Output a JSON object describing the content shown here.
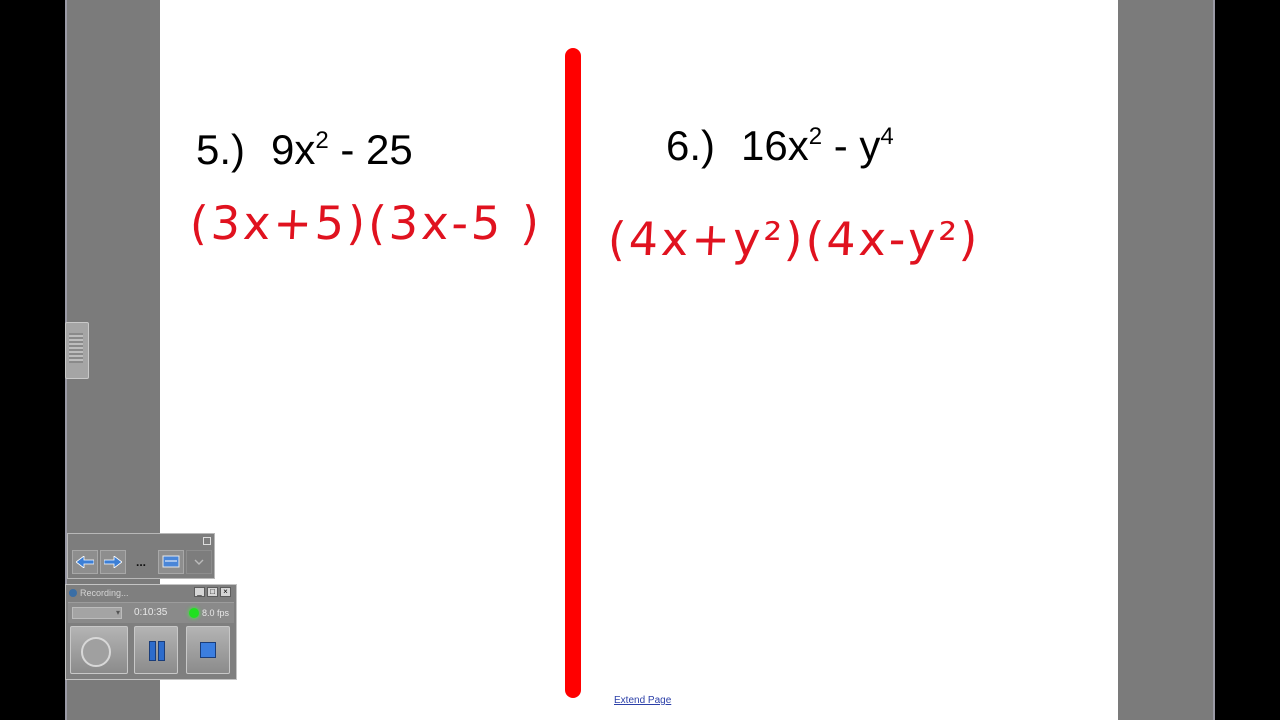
{
  "whiteboard": {
    "problems": [
      {
        "number": "5.)",
        "base": "9x",
        "exp1": "2",
        "rest": " - 25",
        "exp2": ""
      },
      {
        "number": "6.)",
        "base": "16x",
        "exp1": "2",
        "rest": " - y",
        "exp2": "4"
      }
    ],
    "answers": [
      "(3x+5)(3x-5 )",
      "(4x+y²)(4x-y²)"
    ],
    "colors": {
      "ink": "#e0121f",
      "divider": "#ff0000",
      "text": "#000000"
    },
    "extend_page_label": "Extend Page"
  },
  "toolbar": {
    "title": "",
    "buttons": [
      "back-arrow-icon",
      "forward-arrow-icon",
      "more-icon",
      "screen-icon",
      "chevron-down-icon"
    ],
    "more_label": "..."
  },
  "recorder": {
    "title": "Recording...",
    "elapsed": "0:10:35",
    "fps": "8.0 fps",
    "status_color": "#20e020"
  }
}
